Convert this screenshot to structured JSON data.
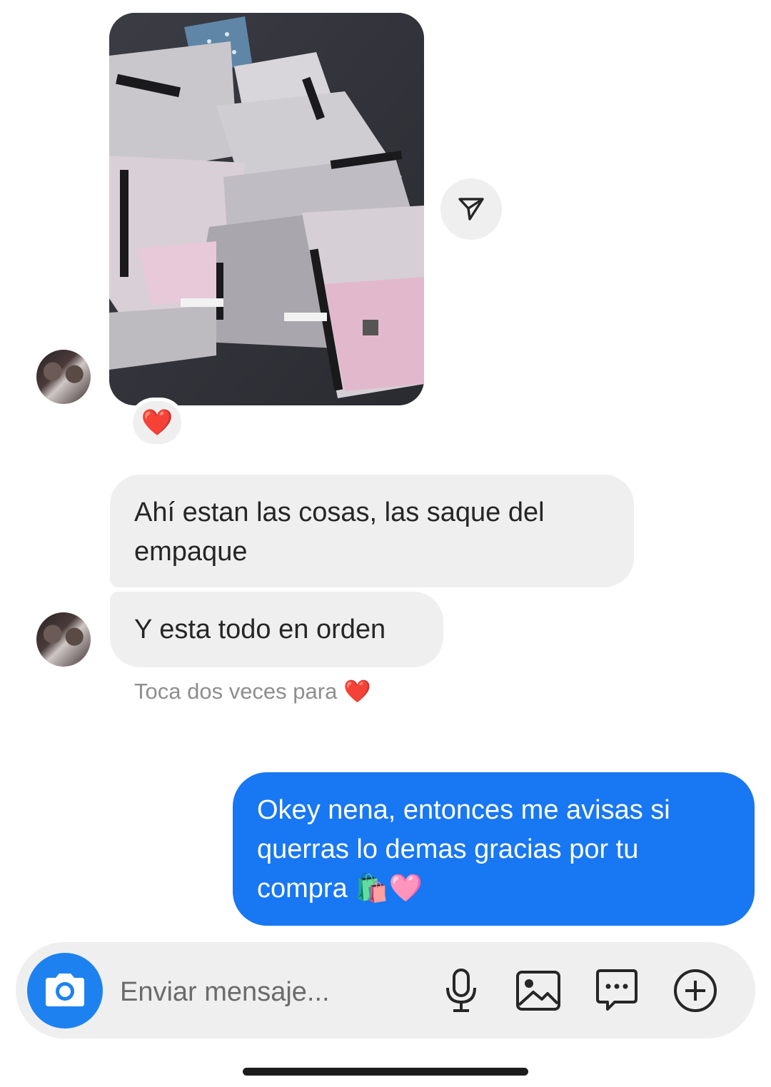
{
  "thread": {
    "incoming_photo": {
      "description_icon": "photo-message",
      "reaction": "❤️"
    },
    "messages_in": [
      {
        "text": "Ahí estan las cosas, las saque del empaque"
      },
      {
        "text": "Y esta todo en orden"
      }
    ],
    "hint": "Toca dos veces para ❤️",
    "messages_out": [
      {
        "text": "Okey nena, entonces me avisas si querras lo demas gracias por tu compra 🛍️🩷"
      }
    ]
  },
  "composer": {
    "placeholder": "Enviar mensaje...",
    "icons": [
      "camera-icon",
      "microphone-icon",
      "gallery-icon",
      "sticker-icon",
      "plus-icon"
    ]
  },
  "colors": {
    "outgoing_bubble": "#1877f2",
    "incoming_bubble": "#efefef",
    "camera_button": "#1d82f0",
    "hint_text": "#8e8e8e"
  }
}
